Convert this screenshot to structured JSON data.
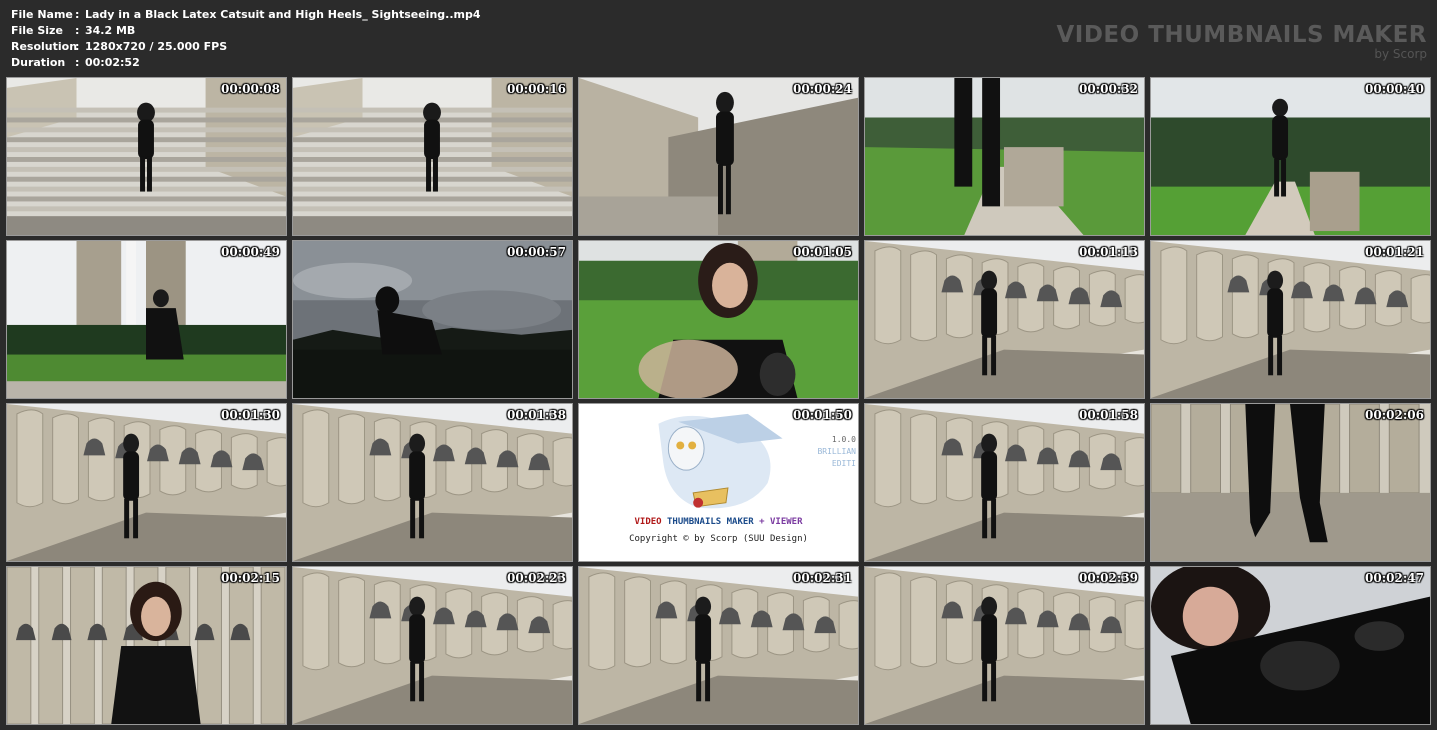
{
  "info": {
    "rows": [
      {
        "label": "File Name",
        "value": "Lady in a Black Latex Catsuit and High Heels_ Sightseeing..mp4"
      },
      {
        "label": "File Size",
        "value": "34.2 MB"
      },
      {
        "label": "Resolution",
        "value": "1280x720 / 25.000 FPS"
      },
      {
        "label": "Duration",
        "value": "00:02:52"
      }
    ]
  },
  "brand": {
    "title": "VIDEO THUMBNAILS MAKER",
    "subtitle": "by Scorp"
  },
  "thumbnails": [
    {
      "time": "00:00:08",
      "scene": "stairs"
    },
    {
      "time": "00:00:16",
      "scene": "stairs"
    },
    {
      "time": "00:00:24",
      "scene": "wall-walk"
    },
    {
      "time": "00:00:32",
      "scene": "park-legs"
    },
    {
      "time": "00:00:40",
      "scene": "park-path"
    },
    {
      "time": "00:00:49",
      "scene": "monument"
    },
    {
      "time": "00:00:57",
      "scene": "silhouette"
    },
    {
      "time": "00:01:05",
      "scene": "portrait-park"
    },
    {
      "time": "00:01:13",
      "scene": "bells"
    },
    {
      "time": "00:01:21",
      "scene": "bells"
    },
    {
      "time": "00:01:30",
      "scene": "bells"
    },
    {
      "time": "00:01:38",
      "scene": "bells"
    },
    {
      "time": "00:01:50",
      "scene": "logo"
    },
    {
      "time": "00:01:58",
      "scene": "bells"
    },
    {
      "time": "00:02:06",
      "scene": "bells-legs"
    },
    {
      "time": "00:02:15",
      "scene": "bells-portrait"
    },
    {
      "time": "00:02:23",
      "scene": "bells"
    },
    {
      "time": "00:02:31",
      "scene": "bells"
    },
    {
      "time": "00:02:39",
      "scene": "bells"
    },
    {
      "time": "00:02:47",
      "scene": "closeup"
    }
  ],
  "logo": {
    "word1": "VIDEO",
    "word2": "THUMBNAILS MAKER",
    "word3": "+ VIEWER",
    "copyright": "Copyright © by Scorp (SUU Design)",
    "version": "1.0.0",
    "edition1": "BRILLIAN",
    "edition2": "EDITI"
  },
  "colors": {
    "background": "#2b2b2b",
    "text": "#ffffff",
    "brand": "#5a5a5a",
    "logo_red": "#b01818",
    "logo_blue": "#1a4a8a",
    "logo_purple": "#7a3aa0"
  }
}
